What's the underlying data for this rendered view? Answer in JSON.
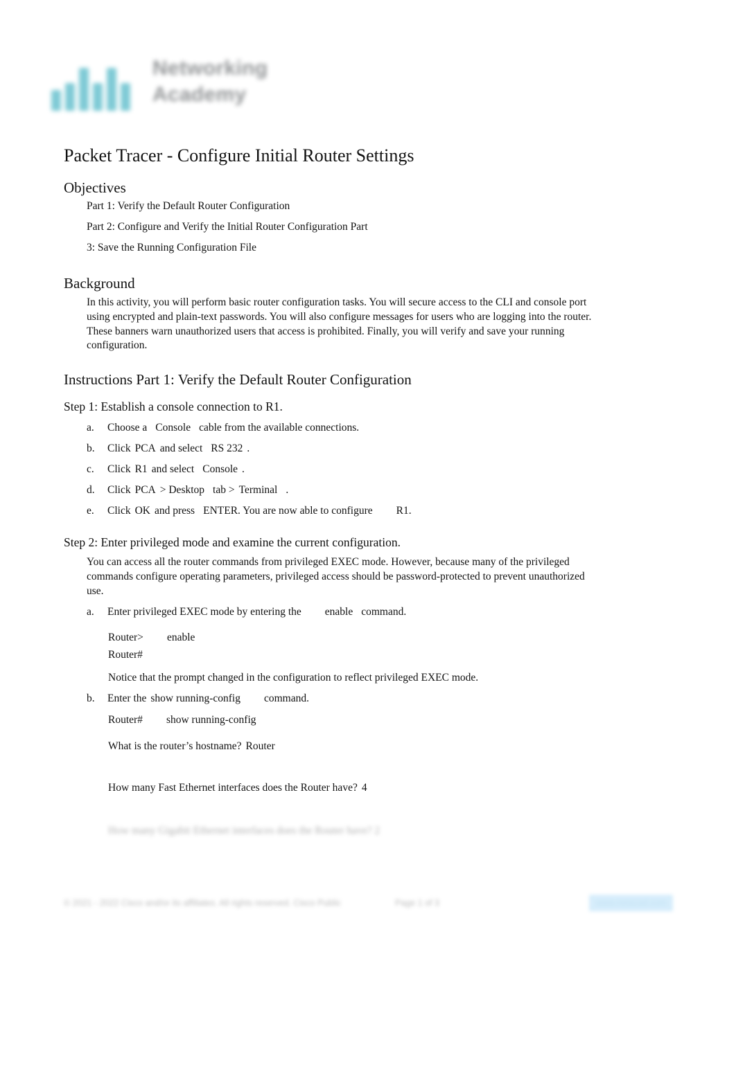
{
  "header": {
    "logo_icon": "cisco-networking-academy-logo",
    "brand_line1": "Networking",
    "brand_line2": "Academy"
  },
  "document": {
    "title": "Packet Tracer - Configure Initial Router Settings"
  },
  "objectives": {
    "heading": "Objectives",
    "lines": [
      "Part 1: Verify the Default Router Configuration",
      "Part 2: Configure and Verify the Initial Router Configuration Part",
      "3: Save the Running Configuration File"
    ]
  },
  "background": {
    "heading": "Background",
    "text": "In this activity, you will perform basic router configuration tasks. You will secure access to the CLI and console port using encrypted and plain-text passwords. You will also configure messages for users who are logging into the router. These banners warn unauthorized users that access is prohibited. Finally, you will verify and save your running configuration."
  },
  "instructions": {
    "heading": "Instructions Part 1: Verify the Default Router Configuration",
    "step1": {
      "heading": "Step 1: Establish a console connection to R1.",
      "items": [
        {
          "marker": "a.",
          "pre": "Choose a",
          "em1": "Console",
          "post": "cable from the available connections."
        },
        {
          "marker": "b.",
          "pre": "Click",
          "em1": "PCA",
          "mid": "and select",
          "em2": "RS 232",
          "post": "."
        },
        {
          "marker": "c.",
          "pre": "Click",
          "em1": "R1",
          "mid": "and select",
          "em2": "Console",
          "post": "."
        },
        {
          "marker": "d.",
          "pre": "Click",
          "em1": "PCA",
          "mid": "> Desktop",
          "em2": "tab >",
          "em3": "Terminal",
          "post": "."
        },
        {
          "marker": "e.",
          "pre": "Click",
          "em1": "OK",
          "mid": "and press",
          "em2": "ENTER",
          "post": ". You are now able to configure",
          "em3": "R1",
          "tail": "."
        }
      ]
    },
    "step2": {
      "heading": "Step 2: Enter privileged mode and examine the current configuration.",
      "intro": "You can access all the router commands from privileged EXEC mode. However, because many of the privileged commands configure operating parameters, privileged access should be password-protected to prevent unauthorized use.",
      "item_a": {
        "marker": "a.",
        "pre": "Enter privileged EXEC mode by entering the",
        "em": "enable",
        "post": "command."
      },
      "cli_a": [
        {
          "prompt": "Router>",
          "command": "enable"
        },
        {
          "prompt": "Router#",
          "command": ""
        }
      ],
      "notice": "Notice that the prompt changed in the configuration to reflect privileged EXEC mode.",
      "item_b": {
        "marker": "b.",
        "pre": "Enter the",
        "em": "show running-config",
        "post": "command."
      },
      "cli_b": [
        {
          "prompt": "Router#",
          "command": "show running-config"
        }
      ],
      "questions": [
        {
          "question": "What is the router’s hostname?",
          "answer": "Router"
        },
        {
          "question": "How many Fast Ethernet interfaces does the Router have?",
          "answer": "4"
        }
      ],
      "redacted_question": "How many Gigabit Ethernet interfaces does the Router have? 2"
    }
  },
  "footer": {
    "copyright": "© 2021 - 2022 Cisco and/or its affiliates. All rights reserved. Cisco Public",
    "page": "Page 1 of 3",
    "source_link": "www.netacad.com",
    "highlight_color": "#cfeafb"
  }
}
